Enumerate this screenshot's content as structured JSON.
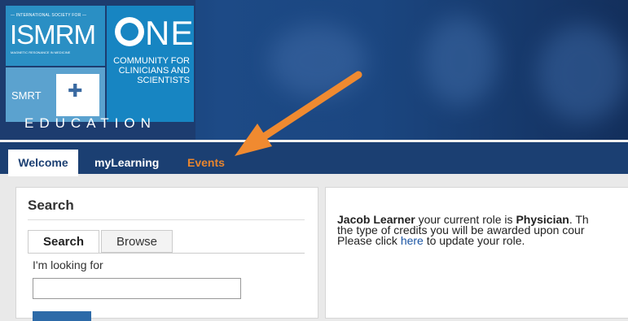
{
  "logo": {
    "society_line": "— INTERNATIONAL SOCIETY FOR —",
    "isrm": "ISMRM",
    "isrm_sub": "MAGNETIC RESONANCE IN MEDICINE",
    "one": "NE",
    "community": "COMMUNITY FOR CLINICIANS AND SCIENTISTS",
    "smrt": "SMRT",
    "education": "EDUCATION"
  },
  "nav": {
    "tabs": [
      {
        "label": "Welcome"
      },
      {
        "label": "myLearning"
      },
      {
        "label": "Events"
      }
    ]
  },
  "search": {
    "title": "Search",
    "tab_search": "Search",
    "tab_browse": "Browse",
    "looking_for_label": "I'm looking for",
    "input_value": ""
  },
  "info": {
    "user_name": "Jacob Learner",
    "role_text": " your current role is ",
    "role": "Physician",
    "line1_tail": ". Th",
    "line2": "the type of credits you will be awarded upon cour",
    "line3_pre": "Please click ",
    "link": "here",
    "line3_post": " to update your role."
  },
  "colors": {
    "nav_bg": "#1b3f72",
    "events_orange": "#e8852e",
    "arrow_orange": "#f08a30"
  }
}
